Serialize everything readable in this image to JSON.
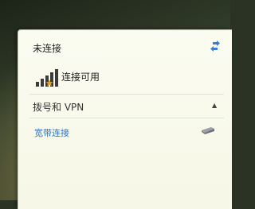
{
  "network_panel": {
    "status_title": "未连接",
    "refresh_icon": "refresh-icon",
    "wifi": {
      "icon": "wifi-signal-icon",
      "label": "连接可用"
    },
    "dialup_section": {
      "title": "拨号和 VPN",
      "collapse_icon": "chevron-up-icon",
      "items": [
        {
          "label": "宽带连接",
          "icon": "dialup-connection-icon"
        }
      ]
    }
  },
  "colors": {
    "panel_bg": "#f8f9ea",
    "link_blue": "#2a73c9",
    "signal_star": "#f09a1a"
  }
}
